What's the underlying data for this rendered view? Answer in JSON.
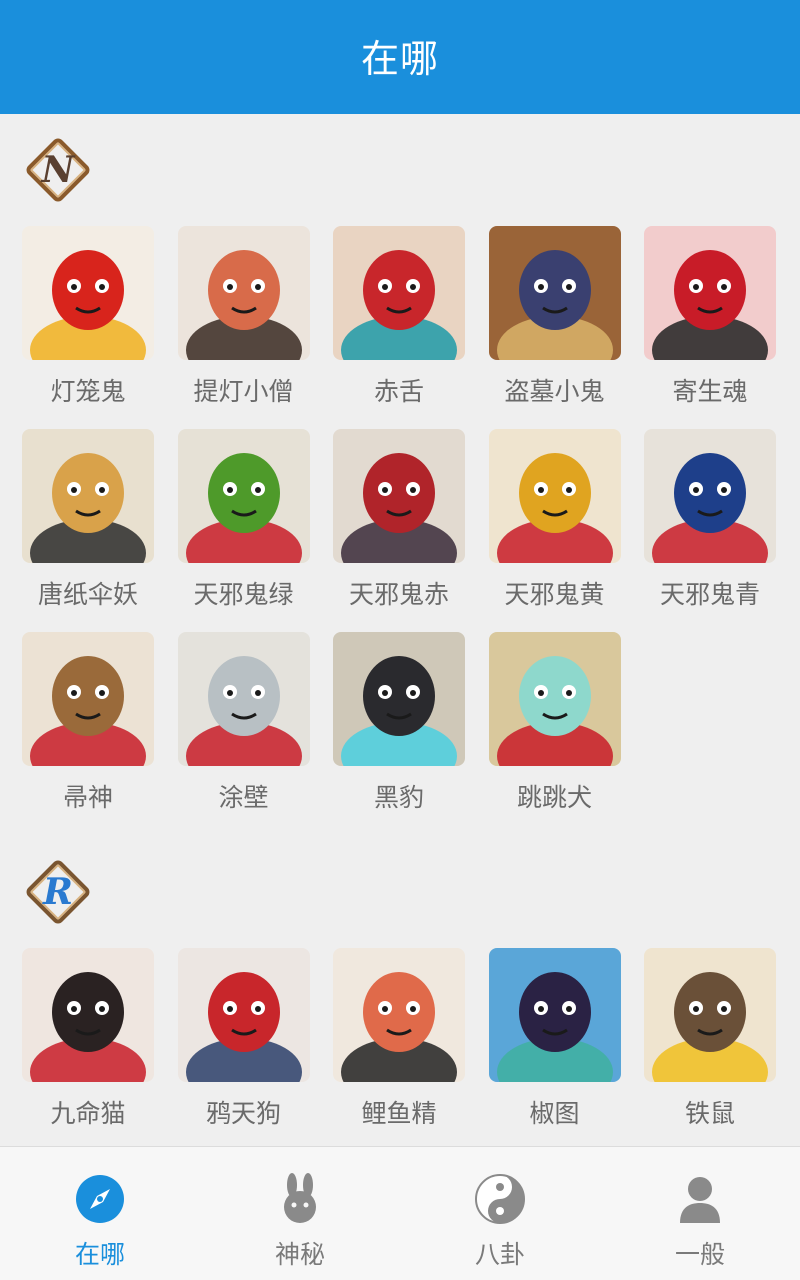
{
  "header": {
    "title": "在哪"
  },
  "sections": [
    {
      "badge": "N",
      "items": [
        {
          "name": "灯笼鬼",
          "bg": "#f3ede4",
          "fg": "#d8241c",
          "accent": "#f0b020"
        },
        {
          "name": "提灯小僧",
          "bg": "#ece4dc",
          "fg": "#d86b4a",
          "accent": "#3a2a22"
        },
        {
          "name": "赤舌",
          "bg": "#e9d4c2",
          "fg": "#c8262b",
          "accent": "#1f9aa8"
        },
        {
          "name": "盗墓小鬼",
          "bg": "#9a6438",
          "fg": "#3a4070",
          "accent": "#d9b36a"
        },
        {
          "name": "寄生魂",
          "bg": "#f2cccc",
          "fg": "#c81c28",
          "accent": "#222222"
        },
        {
          "name": "唐纸伞妖",
          "bg": "#e8e0cf",
          "fg": "#d9a24a",
          "accent": "#2c2c2c"
        },
        {
          "name": "天邪鬼绿",
          "bg": "#e6e1d6",
          "fg": "#4e9a2a",
          "accent": "#c81c28"
        },
        {
          "name": "天邪鬼赤",
          "bg": "#e2dad0",
          "fg": "#b0242a",
          "accent": "#3a2a3a"
        },
        {
          "name": "天邪鬼黄",
          "bg": "#efe4cf",
          "fg": "#e0a420",
          "accent": "#c81c28"
        },
        {
          "name": "天邪鬼青",
          "bg": "#e7e2da",
          "fg": "#1e3f8a",
          "accent": "#c81c28"
        },
        {
          "name": "帚神",
          "bg": "#ece2d4",
          "fg": "#9a6a3a",
          "accent": "#c81c28"
        },
        {
          "name": "涂壁",
          "bg": "#e4e2dc",
          "fg": "#b8c0c4",
          "accent": "#c81c28"
        },
        {
          "name": "黑豹",
          "bg": "#cfc8b8",
          "fg": "#2a2a2e",
          "accent": "#4ad0e0"
        },
        {
          "name": "跳跳犬",
          "bg": "#d9c89c",
          "fg": "#8ed8cc",
          "accent": "#c81c28"
        }
      ]
    },
    {
      "badge": "R",
      "items": [
        {
          "name": "九命猫",
          "bg": "#efe6e0",
          "fg": "#2a2222",
          "accent": "#c81c28"
        },
        {
          "name": "鸦天狗",
          "bg": "#ece6e2",
          "fg": "#c8262b",
          "accent": "#2c3e6a"
        },
        {
          "name": "鲤鱼精",
          "bg": "#f0e8de",
          "fg": "#e06a4a",
          "accent": "#222222"
        },
        {
          "name": "椒图",
          "bg": "#5aa6d8",
          "fg": "#2a2244",
          "accent": "#40b0a0"
        },
        {
          "name": "铁鼠",
          "bg": "#efe4cf",
          "fg": "#6a5038",
          "accent": "#f0c020"
        }
      ]
    }
  ],
  "tabs": [
    {
      "label": "在哪",
      "icon": "compass-icon",
      "active": true
    },
    {
      "label": "神秘",
      "icon": "rabbit-icon",
      "active": false
    },
    {
      "label": "八卦",
      "icon": "yin-yang-icon",
      "active": false
    },
    {
      "label": "一般",
      "icon": "user-icon",
      "active": false
    }
  ],
  "colors": {
    "primary": "#1a8fdc",
    "inactive": "#7a7a7a",
    "n_badge": "#5a4030",
    "r_badge": "#2a7ad0"
  }
}
